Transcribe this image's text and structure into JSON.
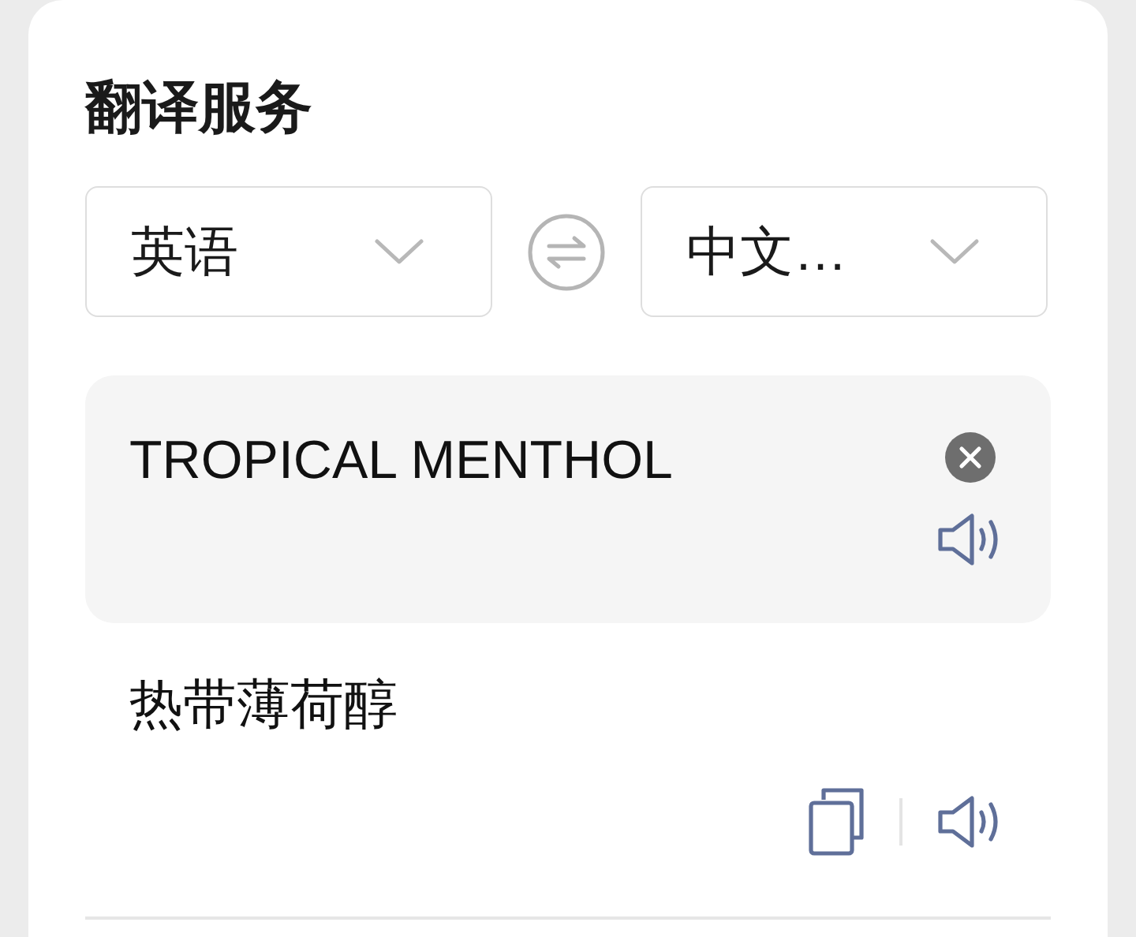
{
  "title": "翻译服务",
  "source_language": {
    "label": "英语"
  },
  "target_language": {
    "label": "中文…"
  },
  "input": {
    "value": "TROPICAL MENTHOL"
  },
  "result": {
    "text": "热带薄荷醇"
  }
}
